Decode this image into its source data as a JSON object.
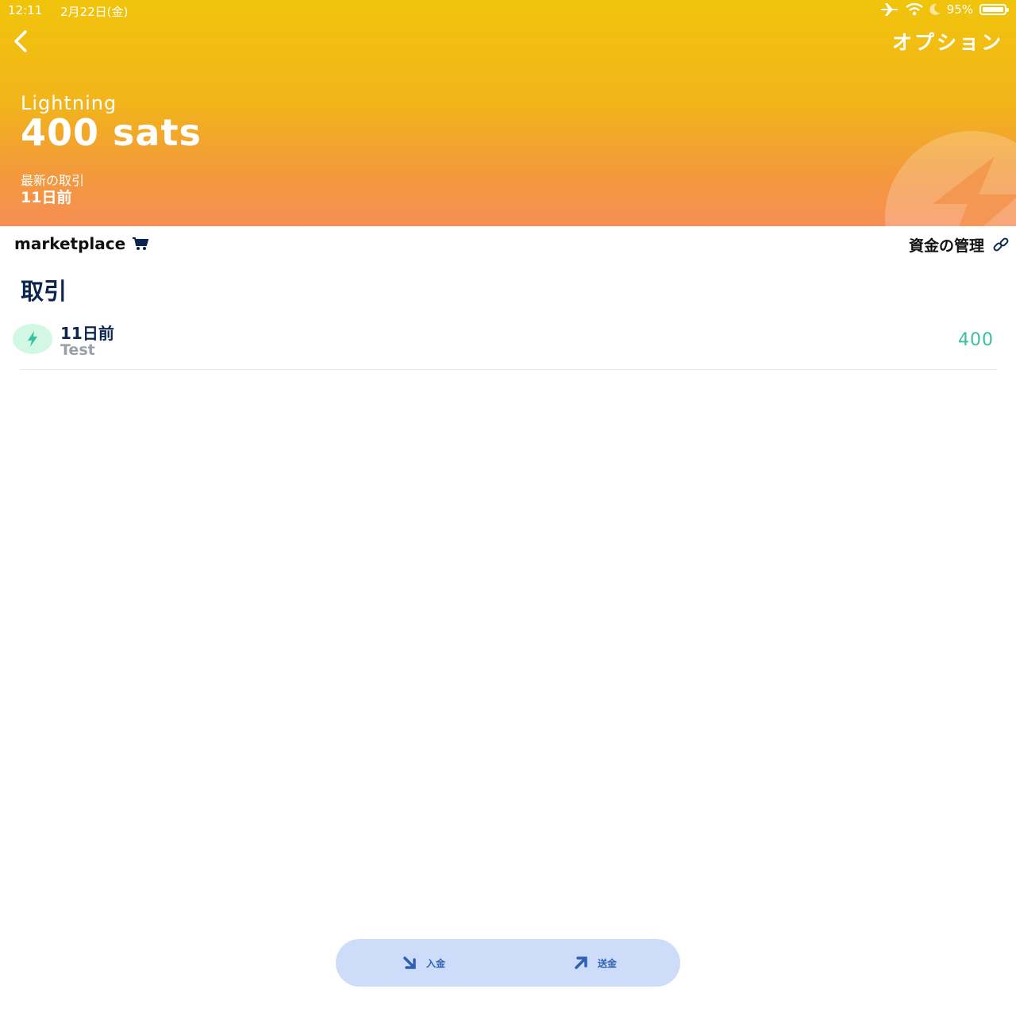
{
  "status_bar": {
    "time": "12:11",
    "date": "2月22日(金)",
    "battery": "95%",
    "icons": [
      "airplane-icon",
      "wifi-icon",
      "moon-icon",
      "battery-icon"
    ]
  },
  "header": {
    "back_icon": "chevron-left-icon",
    "options_label": "オプション",
    "wallet_type": "Lightning",
    "balance": "400 sats",
    "latest_label": "最新の取引",
    "latest_value": "11日前"
  },
  "toolbar": {
    "marketplace_label": "marketplace",
    "marketplace_icon": "cart-icon",
    "manage_label": "資金の管理",
    "manage_icon": "link-icon"
  },
  "transactions": {
    "title": "取引",
    "items": [
      {
        "icon": "lightning-icon",
        "date": "11日前",
        "memo": "Test",
        "amount": "400"
      }
    ]
  },
  "actions": {
    "receive_label": "入金",
    "send_label": "送金"
  },
  "colors": {
    "header_top": "#f1c40b",
    "header_bottom": "#f68e55",
    "text_dark": "#0c2550",
    "amount_green": "#37c0a1",
    "action_bar": "#cddcf8",
    "action_text": "#2f5fb3"
  }
}
